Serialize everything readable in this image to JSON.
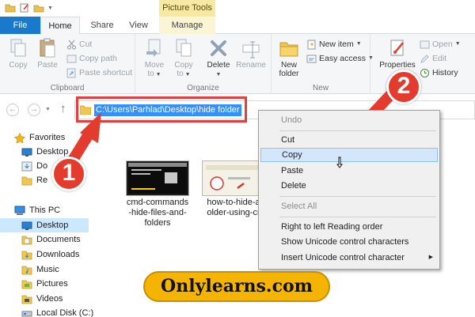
{
  "window": {
    "contextual_tab_group": "Picture Tools"
  },
  "tabs": [
    {
      "label": "File"
    },
    {
      "label": "Home"
    },
    {
      "label": "Share"
    },
    {
      "label": "View"
    },
    {
      "label": "Manage"
    }
  ],
  "ribbon": {
    "clipboard": {
      "label": "Clipboard",
      "copy": "Copy",
      "paste": "Paste",
      "cut": "Cut",
      "copy_path": "Copy path",
      "paste_shortcut": "Paste shortcut"
    },
    "organize": {
      "label": "Organize",
      "move_to": "Move",
      "move_to_2": "to",
      "copy_to": "Copy",
      "copy_to_2": "to",
      "delete": "Delete",
      "rename": "Rename"
    },
    "new": {
      "label": "New",
      "new_folder": "New",
      "new_folder_2": "folder",
      "new_item": "New item",
      "easy_access": "Easy access"
    },
    "open": {
      "properties": "Properties",
      "open": "Open",
      "edit": "Edit",
      "history": "History"
    }
  },
  "address": {
    "path": "C:\\Users\\Parhlad\\Desktop\\hide folder"
  },
  "nav_pane": {
    "favorites": "Favorites",
    "favorites_items": [
      "Desktop",
      "Do",
      "Re"
    ],
    "this_pc": "This PC",
    "this_pc_items": [
      "Desktop",
      "Documents",
      "Downloads",
      "Music",
      "Pictures",
      "Videos",
      "Local Disk (C:)"
    ]
  },
  "files": [
    {
      "line1": "cmd-commands",
      "line2": "-hide-files-and-",
      "line3": "folders"
    },
    {
      "line1": "how-to-hide-a",
      "line2": "older-using-cr",
      "line3": ""
    }
  ],
  "context_menu": {
    "undo": "Undo",
    "cut": "Cut",
    "copy": "Copy",
    "paste": "Paste",
    "delete": "Delete",
    "select_all": "Select All",
    "rtl": "Right to left Reading order",
    "show_unicode": "Show Unicode control characters",
    "insert_unicode": "Insert Unicode control character"
  },
  "annotations": {
    "badge1": "1",
    "badge2": "2",
    "watermark": "Onlylearns.com"
  },
  "colors": {
    "file_tab": "#1979ca",
    "selection": "#3390ff",
    "annotation_red": "#e43b2f",
    "watermark": "#f5b400"
  }
}
